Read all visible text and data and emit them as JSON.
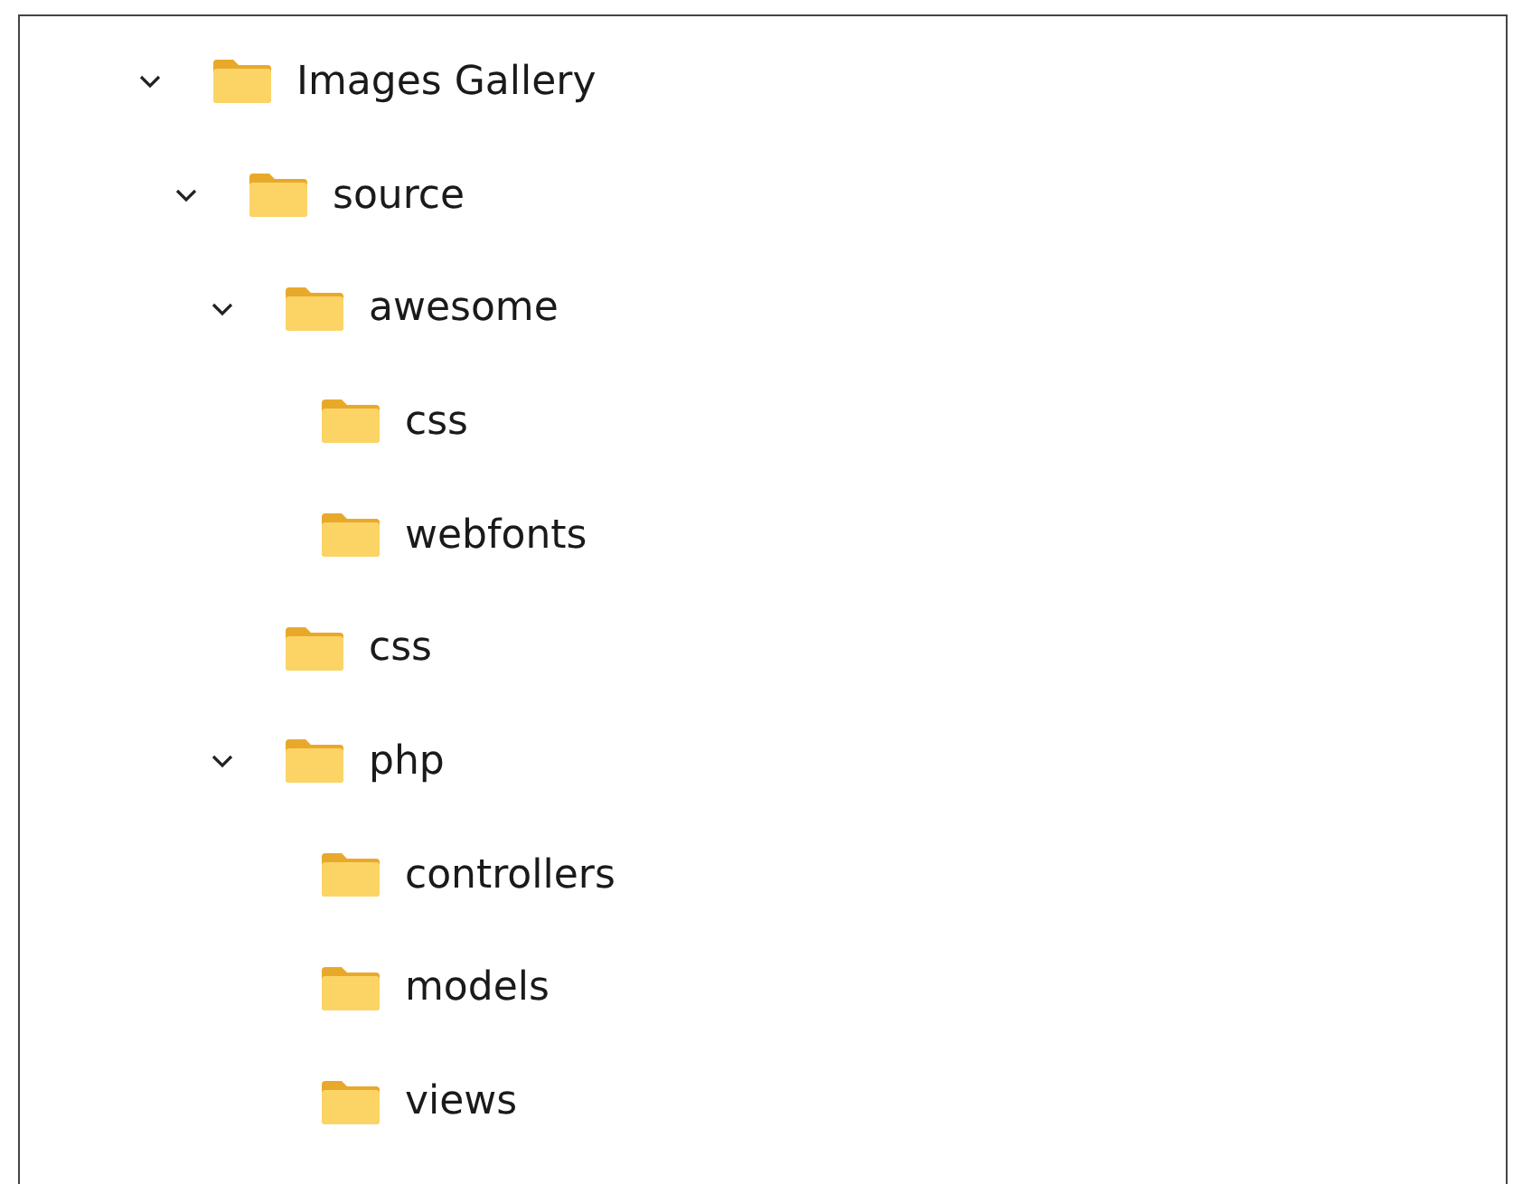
{
  "tree": [
    {
      "name": "Images Gallery",
      "expanded": true,
      "children": [
        {
          "name": "source",
          "expanded": true,
          "children": [
            {
              "name": "awesome",
              "expanded": true,
              "children": [
                {
                  "name": "css"
                },
                {
                  "name": "webfonts"
                }
              ]
            },
            {
              "name": "css"
            },
            {
              "name": "php",
              "expanded": true,
              "children": [
                {
                  "name": "controllers"
                },
                {
                  "name": "models"
                },
                {
                  "name": "views"
                }
              ]
            }
          ]
        }
      ]
    }
  ]
}
